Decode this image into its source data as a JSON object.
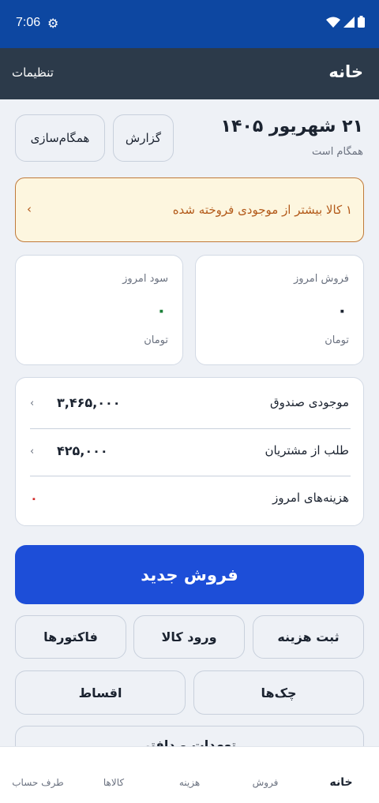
{
  "status_bar": {
    "time": "7:06"
  },
  "app_bar": {
    "title": "خانه",
    "settings": "تنظیمات"
  },
  "header": {
    "date": "۲۱ شهریور ۱۴۰۵",
    "sync_status": "همگام است"
  },
  "actions": {
    "report": "گزارش",
    "sync": "همگام‌سازی"
  },
  "alert": {
    "text": "۱ کالا بیشتر از موجودی فروخته شده",
    "chevron": "‹"
  },
  "stats": {
    "sales_today": {
      "label": "فروش امروز",
      "value": "۰",
      "unit": "تومان"
    },
    "profit_today": {
      "label": "سود امروز",
      "value": "۰",
      "unit": "تومان"
    }
  },
  "summary": {
    "rows": [
      {
        "label": "موجودی صندوق",
        "value": "۳,۴۶۵,۰۰۰",
        "chevron": "‹"
      },
      {
        "label": "طلب از مشتریان",
        "value": "۴۲۵,۰۰۰",
        "chevron": "‹"
      },
      {
        "label": "هزینه‌های امروز",
        "value": "۰"
      }
    ]
  },
  "primary_action": "فروش جدید",
  "quick_actions": {
    "expense": "ثبت هزینه",
    "stock_in": "ورود کالا",
    "invoices": "فاکتورها",
    "cheques": "چک‌ها",
    "installments": "اقساط",
    "partial": "تعهدات و دافتر"
  },
  "bottom_nav": {
    "home": "خانه",
    "sales": "فروش",
    "expense": "هزینه",
    "products": "کالاها",
    "accounts": "طرف حساب"
  },
  "colors": {
    "primary": "#1d4ed8",
    "status_bar": "#0d47a1",
    "app_bar": "#2c3a4a",
    "profit_green": "#1a7f37",
    "expense_red": "#d32f2f",
    "alert_text": "#b35a1a"
  }
}
